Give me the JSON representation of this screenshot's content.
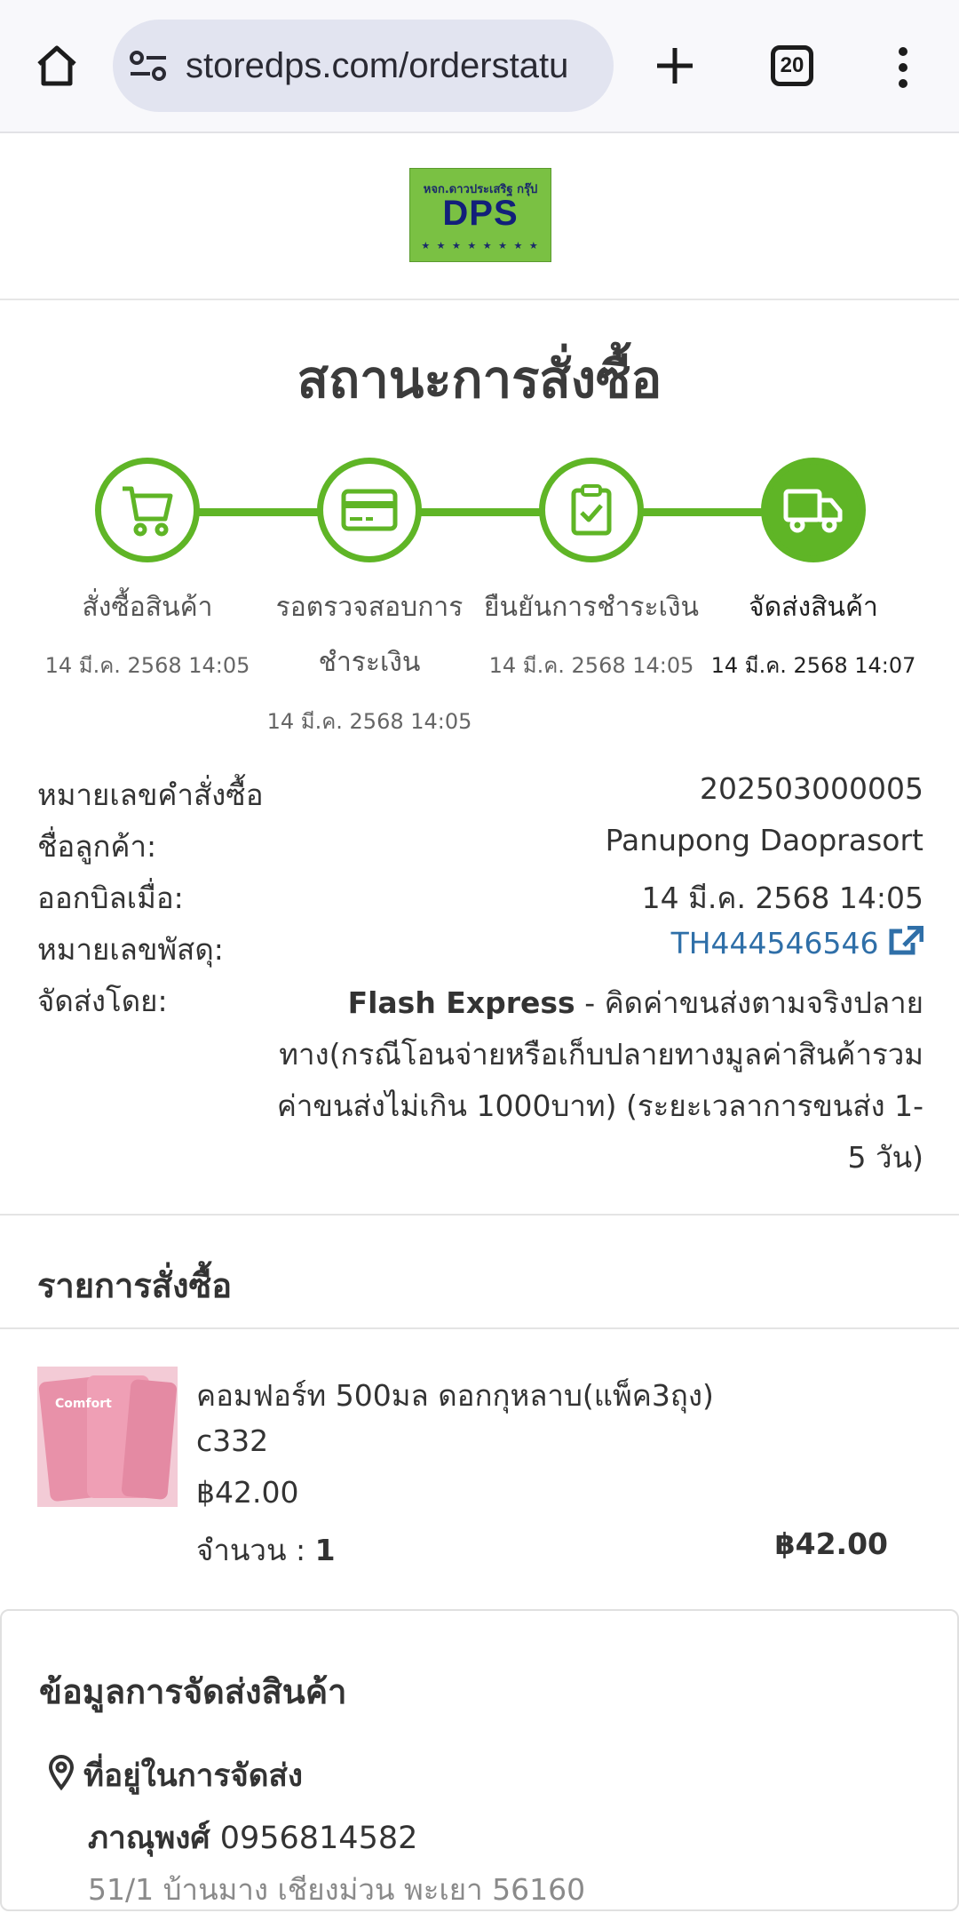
{
  "browser": {
    "url": "storedps.com/orderstatu",
    "tab_count": "20"
  },
  "logo": {
    "small_text": "หจก.ดาวประเสริฐ กรุ๊ป",
    "big_text": "DPS",
    "stars": "★ ★ ★ ★ ★ ★ ★ ★"
  },
  "page_title": "สถานะการสั่งซื้อ",
  "steps": [
    {
      "label": "สั่งซื้อสินค้า",
      "date": "14 มี.ค. 2568 14:05",
      "icon": "cart-icon",
      "active": false
    },
    {
      "label_line1": "รอตรวจสอบการ",
      "label_line2": "ชำระเงิน",
      "date": "14 มี.ค. 2568 14:05",
      "icon": "credit-card-icon",
      "active": false
    },
    {
      "label": "ยืนยันการชำระเงิน",
      "date": "14 มี.ค. 2568 14:05",
      "icon": "clipboard-check-icon",
      "active": false
    },
    {
      "label": "จัดส่งสินค้า",
      "date": "14 มี.ค. 2568 14:07",
      "icon": "truck-icon",
      "active": true
    }
  ],
  "order_info": {
    "order_no_label": "หมายเลขคำสั่งซื้อ",
    "order_no": "202503000005",
    "customer_label": "ชื่อลูกค้า:",
    "customer": "Panupong Daoprasort",
    "billed_label": "ออกบิลเมื่อ:",
    "billed": "14 มี.ค. 2568 14:05",
    "tracking_label": "หมายเลขพัสดุ:",
    "tracking": "TH444546546",
    "shipped_by_label": "จัดส่งโดย:",
    "carrier": "Flash Express",
    "shipping_line1": " - คิดค่าขนส่งตามจริงปลาย",
    "shipping_line2": "ทาง(กรณีโอนจ่ายหรือเก็บปลายทางมูลค่าสินค้ารวม",
    "shipping_line3": "ค่าขนส่งไม่เกิน 1000บาท) (ระยะเวลาการขนส่ง 1-",
    "shipping_line4": "5 วัน)"
  },
  "order_items": {
    "title": "รายการสั่งซื้อ",
    "items": [
      {
        "name": "คอมฟอร์ท 500มล ดอกกุหลาบ(แพ็ค3ถุง)",
        "sku": "c332",
        "price": "฿42.00",
        "qty_label": "จำนวน : ",
        "qty": "1",
        "total": "฿42.00",
        "image_text": "Comfort"
      }
    ]
  },
  "shipping_info": {
    "title": "ข้อมูลการจัดส่งสินค้า",
    "address_title": "ที่อยู่ในการจัดส่ง",
    "recipient_name": "ภาณุพงศ์",
    "recipient_phone": " 0956814582",
    "address": "51/1 บ้านมาง เชียงม่วน พะเยา 56160"
  },
  "colors": {
    "accent_green": "#5fb526",
    "link_blue": "#2f6fa8"
  }
}
